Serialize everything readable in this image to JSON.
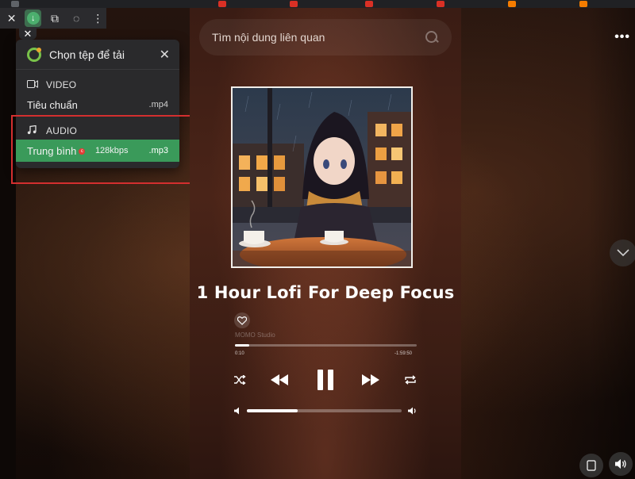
{
  "extension": {
    "toolbar": {
      "close_label": "✕",
      "download_label": "↓",
      "pip_label": "⧉",
      "bulb_label": "◌",
      "menu_label": "⋮"
    },
    "close_chip_label": "✕"
  },
  "download_panel": {
    "title": "Chọn tệp để tải",
    "close_label": "✕",
    "sections": [
      {
        "label": "VIDEO",
        "icon": "video-camera-icon",
        "items": [
          {
            "name": "Tiêu chuẩn",
            "bitrate": "",
            "ext": ".mp4",
            "selected": false
          }
        ]
      },
      {
        "label": "AUDIO",
        "icon": "music-note-icon",
        "items": [
          {
            "name": "Trung bình",
            "badge": "c",
            "bitrate": "128kbps",
            "ext": ".mp3",
            "selected": true
          }
        ]
      }
    ]
  },
  "player": {
    "search_placeholder": "Tìm nội dung liên quan",
    "song_title": "1 Hour Lofi For Deep Focus",
    "artist": "MOMO Studio",
    "time_current": "0:10",
    "time_remaining": "-1:59:50",
    "progress": 0.08,
    "volume": 0.33
  },
  "side": {
    "more_label": "•••",
    "scroll_label": "﹀",
    "corner_left_label": "▯",
    "corner_right_label": "◀)"
  },
  "colors": {
    "accent_green": "#3a9a5a",
    "highlight_red": "#d32f2f",
    "panel_bg": "#2a2a2c"
  }
}
